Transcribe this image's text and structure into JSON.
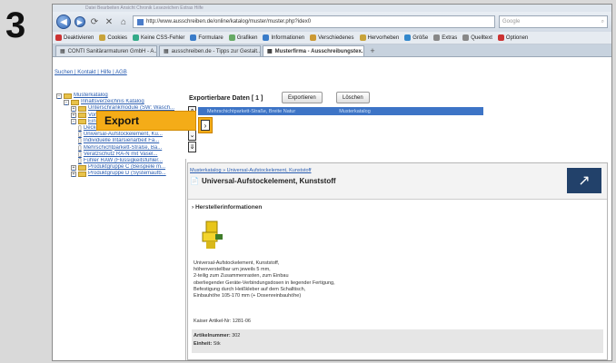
{
  "step": "3",
  "browser": {
    "menubar": "Datei  Bearbeiten  Ansicht  Chronik  Lesezeichen  Extras  Hilfe",
    "url": "http://www.ausschreiben.de/online/katalog/muster/muster.php?idex0",
    "search_placeholder": "Google",
    "toolbar": [
      "Deaktivieren",
      "Cookies",
      "Keine CSS-Fehler",
      "Formulare",
      "Grafiken",
      "Informationen",
      "Verschiedenes",
      "Hervorheben",
      "Größe",
      "Extras",
      "Quelltext",
      "Optionen"
    ],
    "tabs": [
      {
        "label": "CONTI Sanitärarmaturen GmbH - A...",
        "active": false
      },
      {
        "label": "ausschreiben.de - Tipps zur Gestalt...",
        "active": false
      },
      {
        "label": "Musterfirma - Ausschreibungstex...",
        "active": true
      }
    ]
  },
  "page": {
    "toplinks": "Suchen | Kontakt | Hilfe | AGB",
    "tree": [
      {
        "level": 0,
        "toggle": "⊟",
        "kind": "folder",
        "label": "Musterkatalog"
      },
      {
        "level": 1,
        "toggle": "⊟",
        "kind": "folder",
        "label": "Inhaltsverzeichnis Katalog"
      },
      {
        "level": 2,
        "toggle": "⊞",
        "kind": "folder",
        "label": "Unterschrankmodule (SW: Wasch..."
      },
      {
        "level": 2,
        "toggle": "⊞",
        "kind": "folder",
        "label": "Vorwandinstallation ..."
      },
      {
        "level": 2,
        "toggle": "⊟",
        "kind": "folder",
        "label": "Einbau Beispiele m..."
      },
      {
        "level": 3,
        "toggle": "",
        "kind": "doc",
        "label": "Deckenblende mit Einbaukanal"
      },
      {
        "level": 3,
        "toggle": "",
        "kind": "doc",
        "label": "Universal-Aufstockelement, Ku..."
      },
      {
        "level": 3,
        "toggle": "",
        "kind": "doc",
        "label": "Individuelle Intarsienarbeit Fa..."
      },
      {
        "level": 3,
        "toggle": "",
        "kind": "doc",
        "label": "Mehrschichtparkett-Straße, Ba..."
      },
      {
        "level": 3,
        "toggle": "",
        "kind": "doc",
        "label": "Verätzschutz RA-N mit Vasel..."
      },
      {
        "level": 3,
        "toggle": "",
        "kind": "doc",
        "label": "Fühler RAW (Flüssigkeitsfühler..."
      },
      {
        "level": 2,
        "toggle": "⊞",
        "kind": "folder",
        "label": "Produktgruppe C (Beispiele m..."
      },
      {
        "level": 2,
        "toggle": "⊞",
        "kind": "folder",
        "label": "Produktgruppe D (Systemaufb..."
      }
    ],
    "export": {
      "title": "Exportierbare Daten [ 1 ]",
      "export_button": "Exportieren",
      "delete_button": "Löschen",
      "row_name": "Mehrschichtparkett-Straße, Breite Natur",
      "row_catalog": "Musterkatalog",
      "badge": "Export"
    },
    "detail": {
      "breadcrumb": "Musterkatalog  »  Universal-Aufstockelement, Kunststoff",
      "title": "Universal-Aufstockelement, Kunststoff",
      "subhead": "Herstellerinformationen",
      "description": [
        "Universal-Aufstockelement, Kunststoff,",
        "höhenverstellbar um jeweils 5 mm,",
        "2-teilig zum Zusammenrasten, zum Einbau",
        "oberliegender Geräte-Verbindungsdosen in liegender Fertigung,",
        "Befestigung durch Heißkleber auf dem Schalltisch,",
        "Einbauhöhe 105-170 mm (+ Dosenreinbauhöhe)"
      ],
      "article": "Kaiser Artikel-Nr: 1281-06",
      "artikelnummer_label": "Artikelnummer:",
      "artikelnummer_value": "302",
      "einheit_label": "Einheit:",
      "einheit_value": "Stk"
    }
  }
}
